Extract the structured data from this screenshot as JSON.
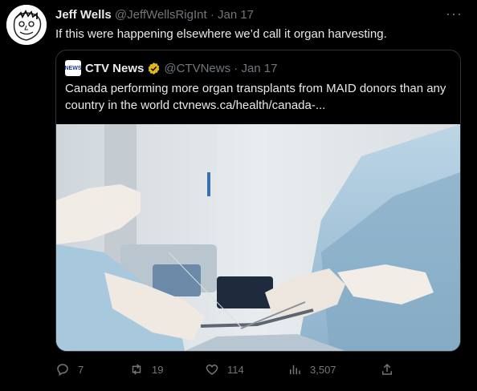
{
  "author": {
    "display_name": "Jeff Wells",
    "handle": "@JeffWellsRigInt",
    "separator": "·",
    "date": "Jan 17"
  },
  "tweet_text": "If this were happening elsewhere we’d call it organ harvesting.",
  "more_label": "···",
  "quoted": {
    "logo_text": "NEWS",
    "display_name": "CTV News",
    "handle": "@CTVNews",
    "separator": "·",
    "date": "Jan 17",
    "text": "Canada performing more organ transplants from MAID donors than any country in the world ctvnews.ca/health/canada-..."
  },
  "actions": {
    "replies": "7",
    "retweets": "19",
    "likes": "114",
    "views": "3,507"
  },
  "colors": {
    "background": "#000000",
    "text": "#e7e9ea",
    "muted": "#71767b",
    "border": "#2f3336",
    "verified_gold": "#e2b719"
  },
  "icons": [
    "avatar-sketch",
    "ctv-logo",
    "verified-badge-icon",
    "more-icon",
    "reply-icon",
    "retweet-icon",
    "like-icon",
    "views-icon",
    "share-icon"
  ]
}
